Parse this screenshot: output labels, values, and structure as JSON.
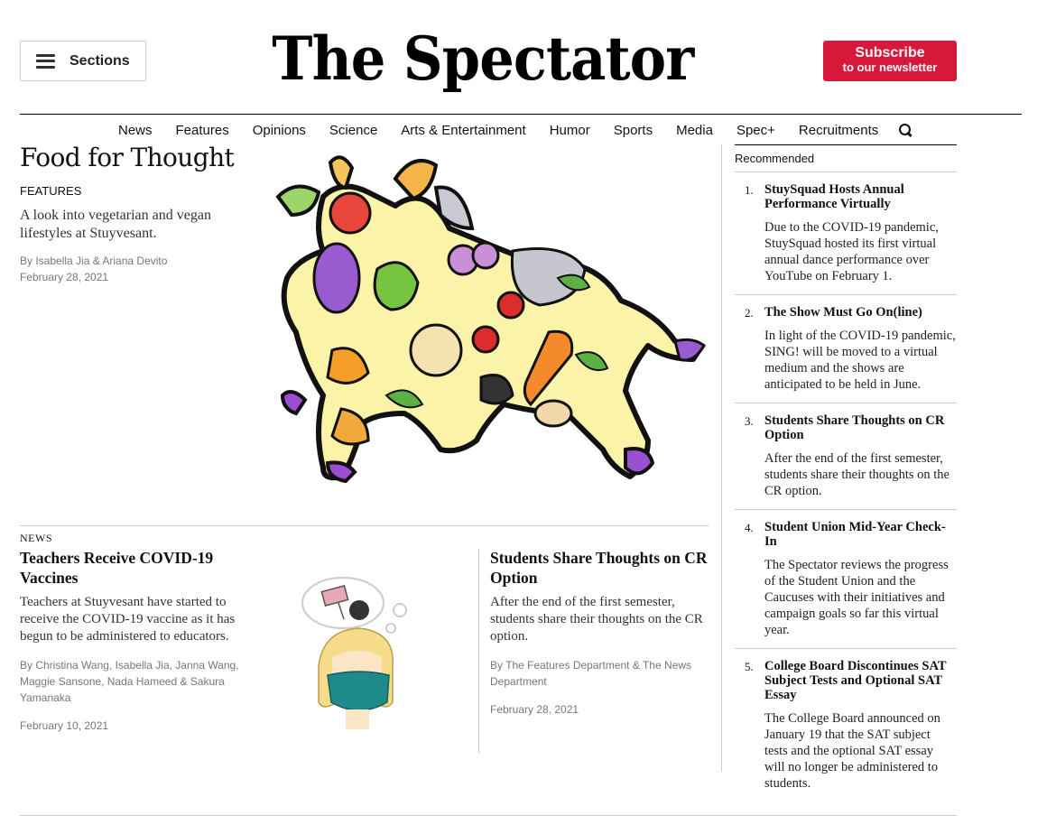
{
  "header": {
    "sections_label": "Sections",
    "masthead": "The Spectator",
    "subscribe_line1": "Subscribe",
    "subscribe_line2": "to our newsletter",
    "subscribe_color": "#d8183a"
  },
  "nav": {
    "items": [
      "News",
      "Features",
      "Opinions",
      "Science",
      "Arts & Entertainment",
      "Humor",
      "Sports",
      "Media",
      "Spec+",
      "Recruitments"
    ],
    "search_icon": "search-icon"
  },
  "featured": {
    "title": "Food for Thought",
    "section": "FEATURES",
    "summary": "A look into vegetarian and vegan lifestyles at Stuyvesant.",
    "byline": "By Isabella Jia & Ariana Devito",
    "date": "February 28, 2021"
  },
  "cards": [
    {
      "section": "NEWS",
      "title": "Teachers Receive COVID-19 Vaccines",
      "summary": "Teachers at Stuyvesant have started to receive the COVID-19 vaccine as it has begun to be administered to educators.",
      "byline": "By Christina Wang, Isabella Jia, Janna Wang, Maggie Sansone, Nada Hameed & Sakura Yamanaka",
      "date": "February 10, 2021"
    },
    {
      "title": "Students Share Thoughts on CR Option",
      "summary": "After the end of the first semester, students share their thoughts on the CR option.",
      "byline": "By The Features Department & The News Department",
      "date": "February 28, 2021"
    }
  ],
  "sidebar": {
    "heading": "Recommended",
    "items": [
      {
        "num": "1.",
        "title": "StuySquad Hosts Annual Performance Virtually",
        "summary": "Due to the COVID-19 pandemic, StuySquad hosted its first virtual annual dance performance over YouTube on February 1."
      },
      {
        "num": "2.",
        "title": "The Show Must Go On(line)",
        "summary": "In light of the COVID-19 pandemic, SING! will be moved to a virtual medium and the shows are anticipated to be held in June."
      },
      {
        "num": "3.",
        "title": "Students Share Thoughts on CR Option",
        "summary": "After the end of the first semester, students share their thoughts on the CR option."
      },
      {
        "num": "4.",
        "title": "Student Union Mid-Year Check-In",
        "summary": "The Spectator reviews the progress of the Student Union and the Caucuses with their initiatives and campaign goals so far this virtual year."
      },
      {
        "num": "5.",
        "title": "College Board Discontinues SAT Subject Tests and Optional SAT Essay",
        "summary": "The College Board announced on January 19 that the SAT subject tests and the optional SAT essay will no longer be administered to students."
      }
    ]
  }
}
